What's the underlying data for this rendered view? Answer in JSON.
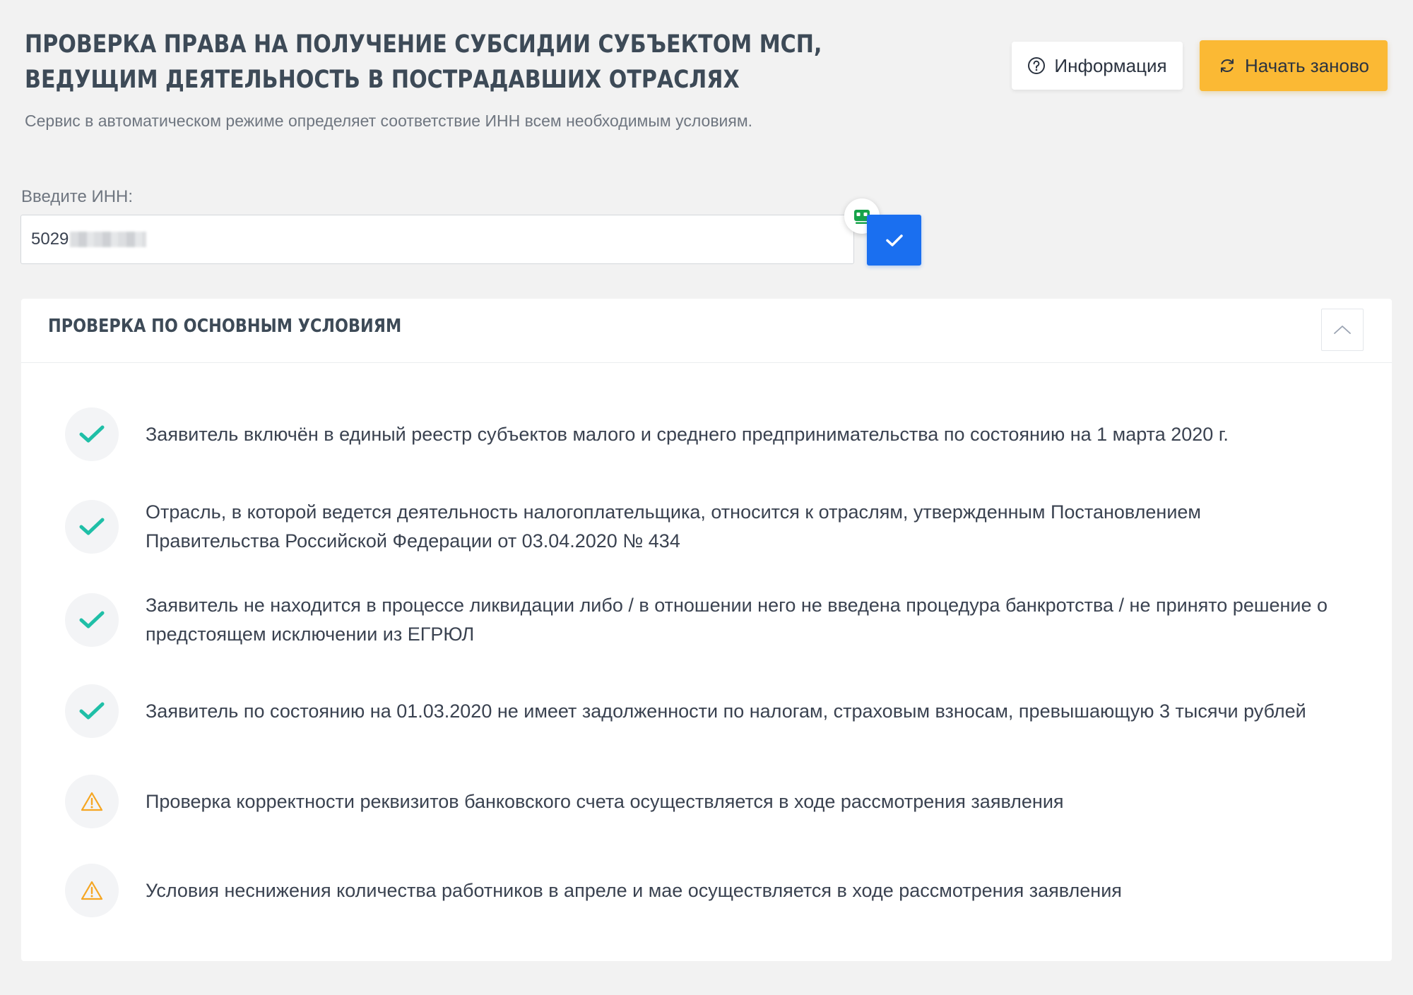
{
  "header": {
    "title": "ПРОВЕРКА ПРАВА НА ПОЛУЧЕНИЕ СУБСИДИИ СУБЪЕКТОМ МСП, ВЕДУЩИМ ДЕЯТЕЛЬНОСТЬ В ПОСТРАДАВШИХ ОТРАСЛЯХ",
    "subtitle": "Сервис в автоматическом режиме определяет соответствие ИНН всем необходимым условиям.",
    "info_button": "Информация",
    "restart_button": "Начать заново"
  },
  "inn": {
    "label": "Введите ИНН:",
    "value": "5029"
  },
  "panel": {
    "title": "ПРОВЕРКА ПО ОСНОВНЫМ УСЛОВИЯМ",
    "conditions": [
      {
        "status": "ok",
        "text": "Заявитель включён в единый реестр субъектов малого и среднего предпринимательства по состоянию на 1 марта 2020 г."
      },
      {
        "status": "ok",
        "text": "Отрасль, в которой ведется деятельность налогоплательщика, относится к отраслям, утвержденным Постановлением Правительства Российской Федерации от 03.04.2020 № 434"
      },
      {
        "status": "ok",
        "text": "Заявитель не находится в процессе ликвидации либо / в отношении него не введена процедура банкротства / не принято решение о предстоящем исключении из ЕГРЮЛ"
      },
      {
        "status": "ok",
        "text": "Заявитель по состоянию на 01.03.2020 не имеет задолженности по налогам, страховым взносам, превышающую 3 тысячи рублей"
      },
      {
        "status": "warning",
        "text": "Проверка корректности реквизитов банковского счета осуществляется в ходе рассмотрения заявления"
      },
      {
        "status": "warning",
        "text": "Условия неснижения количества работников в апреле и мае осуществляется в ходе рассмотрения заявления"
      }
    ]
  },
  "colors": {
    "accent_blue": "#1a6ff0",
    "accent_yellow": "#fbb934",
    "check_teal": "#1fbfa7",
    "warning_orange": "#f5a623"
  },
  "icons": {
    "info": "question-circle-icon",
    "restart": "refresh-icon",
    "submit": "check-icon",
    "badge": "robot-icon",
    "collapse": "chevron-up-icon",
    "ok": "check-icon",
    "warning": "warning-triangle-icon"
  }
}
